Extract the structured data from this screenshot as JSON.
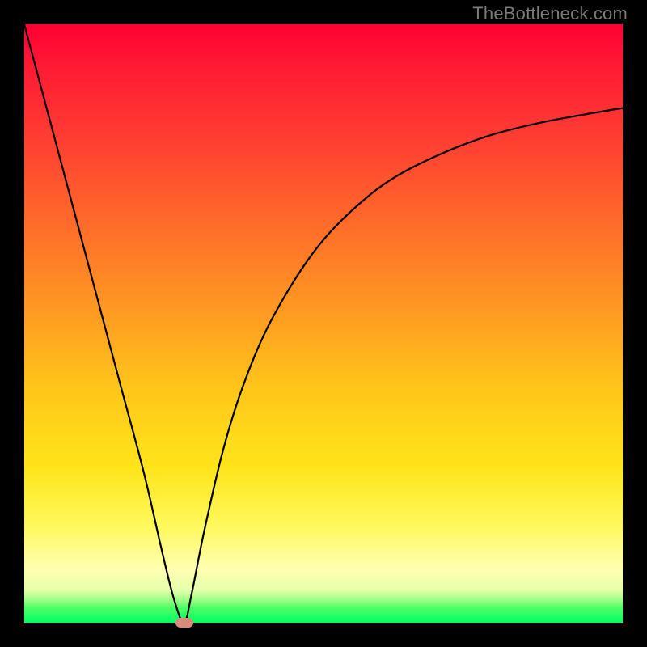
{
  "watermark": "TheBottleneck.com",
  "chart_data": {
    "type": "line",
    "title": "",
    "xlabel": "",
    "ylabel": "",
    "xlim": [
      0,
      100
    ],
    "ylim": [
      0,
      100
    ],
    "series": [
      {
        "name": "bottleneck-curve",
        "x": [
          0,
          4,
          8,
          12,
          16,
          20,
          23,
          25,
          26.7,
          28,
          30,
          33,
          36,
          40,
          45,
          50,
          56,
          62,
          70,
          78,
          86,
          94,
          100
        ],
        "y": [
          100,
          85,
          70,
          55,
          40,
          25,
          12,
          4,
          0,
          5,
          15,
          28,
          38,
          48,
          57,
          64,
          70,
          74.5,
          78.5,
          81.5,
          83.5,
          85,
          86
        ]
      }
    ],
    "marker": {
      "x": 26.7,
      "y": 0,
      "label": "optimal-point"
    },
    "background_gradient": {
      "top": "#ff0033",
      "mid_upper": "#ff9a22",
      "mid_lower": "#fff95e",
      "bottom": "#00ff66"
    }
  },
  "colors": {
    "curve": "#000000",
    "marker": "#d98a7a",
    "frame": "#000000"
  }
}
